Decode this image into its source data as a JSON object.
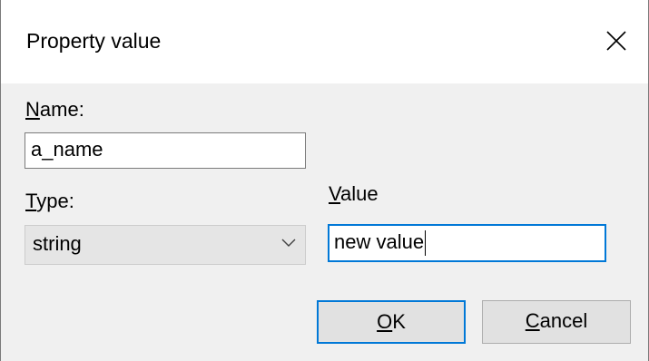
{
  "window": {
    "title": "Property value",
    "close_icon": "close-icon"
  },
  "form": {
    "name_label_accel": "N",
    "name_label_rest": "ame:",
    "name_value": "a_name",
    "type_label_accel": "T",
    "type_label_rest": "ype:",
    "type_selected": "string",
    "value_label_accel": "V",
    "value_label_rest": "alue",
    "value_value": "new value"
  },
  "buttons": {
    "ok_accel": "O",
    "ok_rest": "K",
    "cancel_accel": "C",
    "cancel_rest": "ancel"
  },
  "colors": {
    "accent": "#0078d7",
    "dialog_bg": "#f0f0f0",
    "titlebar_bg": "#ffffff"
  }
}
